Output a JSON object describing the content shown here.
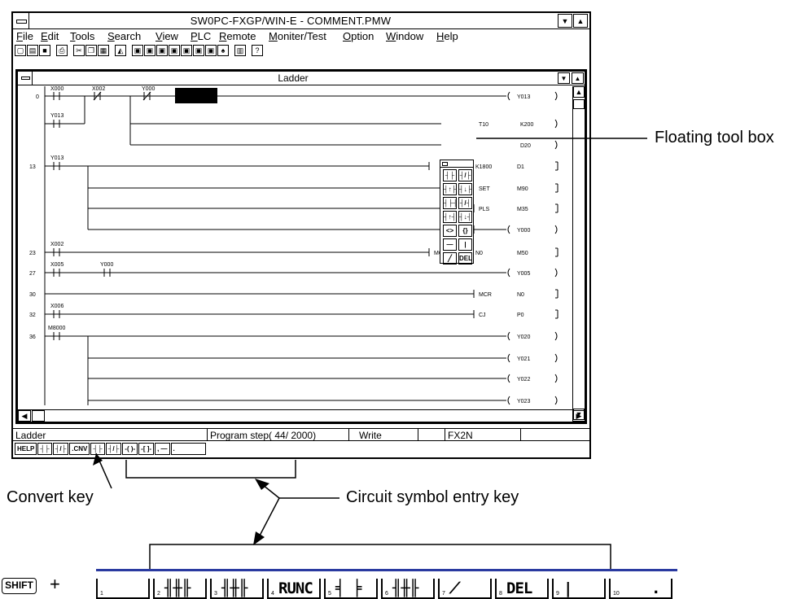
{
  "app": {
    "title": "SW0PC-FXGP/WIN-E - COMMENT.PMW",
    "menu": [
      "File",
      "Edit",
      "Tools",
      "Search",
      "View",
      "PLC",
      "Remote",
      "Moniter/Test",
      "Option",
      "Window",
      "Help"
    ],
    "menu_mnemonic": [
      "F",
      "E",
      "T",
      "S",
      "V",
      "P",
      "R",
      "M",
      "O",
      "W",
      "H"
    ]
  },
  "ladder": {
    "title": "Ladder",
    "step_numbers": [
      "0",
      "13",
      "23",
      "27",
      "30",
      "32",
      "36"
    ],
    "contacts": [
      "X000",
      "X002",
      "Y000",
      "Y013",
      "Y013",
      "X002",
      "X005",
      "Y000",
      "X006",
      "M8000"
    ],
    "coils": [
      "Y013",
      "Y000",
      "Y005",
      "Y020",
      "Y021",
      "Y022",
      "Y023"
    ],
    "instructions": [
      {
        "op": "T10",
        "arg": "K200"
      },
      {
        "op": "",
        "arg": "D20"
      },
      {
        "op": "",
        "arg": "K1800",
        "arg2": "D1"
      },
      {
        "op": "SET",
        "arg": "M90"
      },
      {
        "op": "PLS",
        "arg": "M35"
      },
      {
        "op": "MC",
        "arg": "N0",
        "arg2": "M50"
      },
      {
        "op": "MCR",
        "arg": "N0"
      },
      {
        "op": "CJ",
        "arg": "P0"
      }
    ]
  },
  "toolbox": {
    "buttons": [
      "┤├",
      "┤/├",
      "┤↑├",
      "┤↓├",
      "┤├┤",
      "┤/┤",
      "┤↑┤",
      "┤↓┤",
      "<>",
      "{}",
      "—",
      "|",
      "╱",
      "DEL"
    ]
  },
  "status": {
    "mode": "Ladder",
    "program_step": "Program step(  44/ 2000)",
    "access": "Write",
    "plc": "FX2N"
  },
  "fkeys": [
    "HELP",
    "┤├",
    "┤/├",
    ".CNV",
    "┤├",
    "┤/├",
    "-( )-",
    "-[ ]-",
    ", —",
    "."
  ],
  "annotations": {
    "floating_tool_box": "Floating tool box",
    "convert_key": "Convert key",
    "circuit_symbol_entry_key": "Circuit symbol entry key"
  },
  "shift_row": {
    "shift_label": "SHIFT",
    "plus": "+",
    "keys": [
      {
        "num": "1",
        "label": ""
      },
      {
        "num": "2",
        "label": "╢╫╟"
      },
      {
        "num": "3",
        "label": "╢╫╟"
      },
      {
        "num": "4",
        "label": "RUNC"
      },
      {
        "num": "5",
        "label": "╡ ╞"
      },
      {
        "num": "6",
        "label": "╢╫╟"
      },
      {
        "num": "7",
        "label": "⟋"
      },
      {
        "num": "8",
        "label": "DEL"
      },
      {
        "num": "9",
        "label": "|"
      },
      {
        "num": "10",
        "label": "."
      }
    ]
  }
}
